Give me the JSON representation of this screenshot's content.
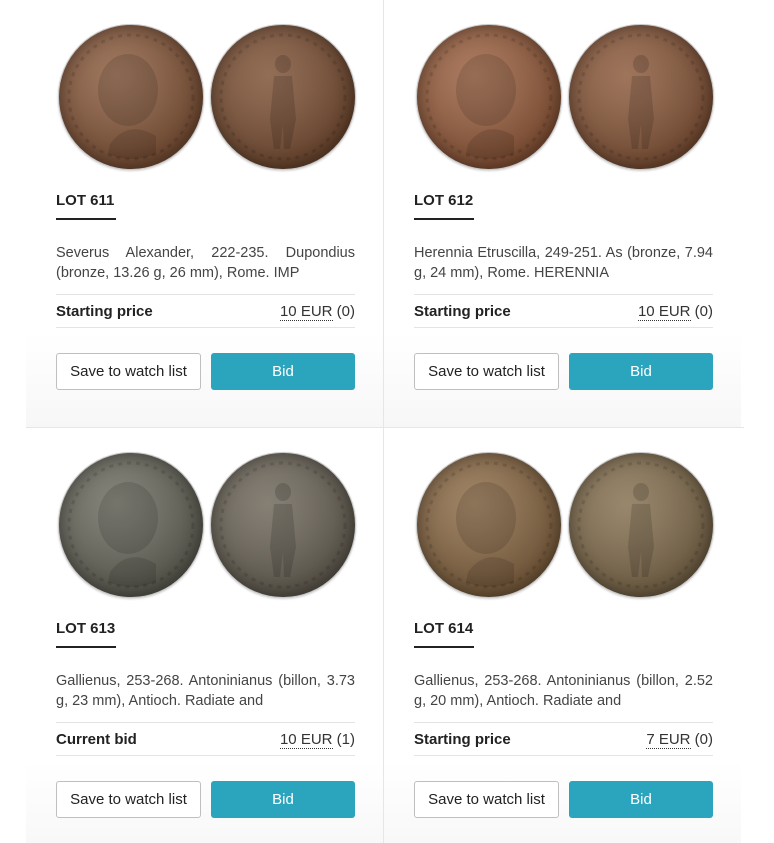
{
  "colors": {
    "bid_button": "#2aa5bd",
    "divider": "#e6e6e6"
  },
  "lots": [
    {
      "title": "LOT 611",
      "description": "Severus Alexander, 222-235. Dupondius (bronze, 13.26 g, 26 mm), Rome. IMP",
      "price_label": "Starting price",
      "price_amount": "10 EUR",
      "bid_count": " (0)",
      "watch_label": "Save to watch list",
      "bid_label": "Bid",
      "obverse_color": "#8a5a3c",
      "reverse_color": "#7e5236"
    },
    {
      "title": "LOT 612",
      "description": "Herennia Etruscilla, 249-251. As (bronze, 7.94 g, 24 mm), Rome. HERENNIA",
      "price_label": "Starting price",
      "price_amount": "10 EUR",
      "bid_count": " (0)",
      "watch_label": "Save to watch list",
      "bid_label": "Bid",
      "obverse_color": "#9a5f3e",
      "reverse_color": "#8c5a3c"
    },
    {
      "title": "LOT 613",
      "description": "Gallienus, 253-268. Antoninianus (billon, 3.73 g, 23 mm), Antioch. Radiate and",
      "price_label": "Current bid",
      "price_amount": "10 EUR",
      "bid_count": " (1)",
      "watch_label": "Save to watch list",
      "bid_label": "Bid",
      "obverse_color": "#6b6a5e",
      "reverse_color": "#6e675a"
    },
    {
      "title": "LOT 614",
      "description": "Gallienus, 253-268. Antoninianus (billon, 2.52 g, 20 mm), Antioch. Radiate and",
      "price_label": "Starting price",
      "price_amount": "7 EUR",
      "bid_count": " (0)",
      "watch_label": "Save to watch list",
      "bid_label": "Bid",
      "obverse_color": "#8c6a45",
      "reverse_color": "#857050"
    }
  ]
}
